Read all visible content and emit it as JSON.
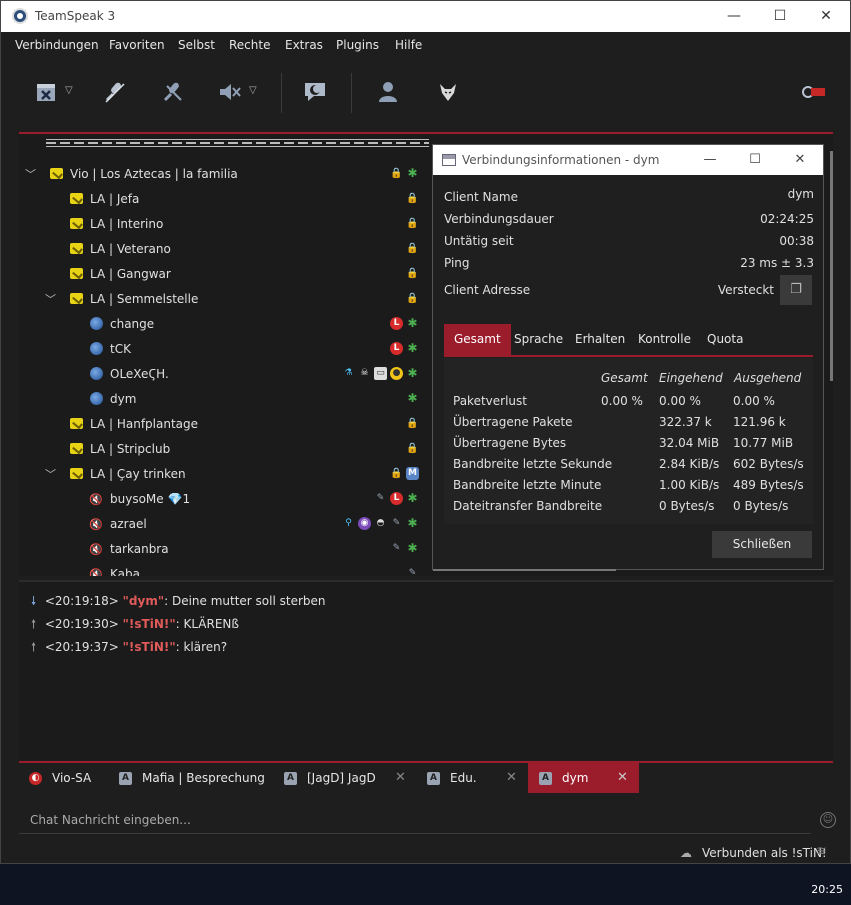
{
  "window": {
    "title": "TeamSpeak 3"
  },
  "menu": [
    "Verbindungen",
    "Favoriten",
    "Selbst",
    "Rechte",
    "Extras",
    "Plugins",
    "Hilfe"
  ],
  "tree": [
    {
      "label": "Vio | Los Aztecas | la familia",
      "kind": "server-channel",
      "level": 0,
      "expanded": true
    },
    {
      "label": "LA | Jefa",
      "kind": "channel",
      "level": 1
    },
    {
      "label": "LA | Interino",
      "kind": "channel",
      "level": 1
    },
    {
      "label": "LA | Veterano",
      "kind": "channel",
      "level": 1
    },
    {
      "label": "LA | Gangwar",
      "kind": "channel",
      "level": 1
    },
    {
      "label": "LA | Semmelstelle",
      "kind": "channel",
      "level": 1,
      "expanded": true
    },
    {
      "label": "change",
      "kind": "user",
      "level": 2
    },
    {
      "label": "tCK",
      "kind": "user",
      "level": 2
    },
    {
      "label": "OLeXeϚH.",
      "kind": "user",
      "level": 2
    },
    {
      "label": "dym",
      "kind": "user",
      "level": 2
    },
    {
      "label": "LA | Hanfplantage",
      "kind": "channel",
      "level": 1
    },
    {
      "label": "LA | Stripclub",
      "kind": "channel",
      "level": 1
    },
    {
      "label": "LA | Çay trinken",
      "kind": "channel",
      "level": 1,
      "expanded": true
    },
    {
      "label": "buysoMe",
      "suffix": "1",
      "kind": "muted-user",
      "level": 2
    },
    {
      "label": "azrael",
      "kind": "muted-user",
      "level": 2
    },
    {
      "label": "tarkanbra",
      "kind": "muted-user",
      "level": 2
    },
    {
      "label": "Kaba",
      "kind": "muted-user",
      "level": 2
    }
  ],
  "dialog": {
    "title": "Verbindungsinformationen - dym",
    "info": [
      {
        "label": "Client Name",
        "value": "dym"
      },
      {
        "label": "Verbindungsdauer",
        "value": "02:24:25"
      },
      {
        "label": "Untätig seit",
        "value": "00:38"
      },
      {
        "label": "Ping",
        "value": "23 ms ± 3.3"
      },
      {
        "label": "Client Adresse",
        "value": "Versteckt"
      }
    ],
    "tabs": [
      "Gesamt",
      "Sprache",
      "Erhalten",
      "Kontrolle",
      "Quota"
    ],
    "active_tab": "Gesamt",
    "stats_headers": [
      "Gesamt",
      "Eingehend",
      "Ausgehend"
    ],
    "stats": [
      {
        "label": "Paketverlust",
        "gesamt": "0.00 %",
        "ein": "0.00 %",
        "aus": "0.00 %"
      },
      {
        "label": "Übertragene Pakete",
        "gesamt": "",
        "ein": "322.37 k",
        "aus": "121.96 k"
      },
      {
        "label": "Übertragene Bytes",
        "gesamt": "",
        "ein": "32.04 MiB",
        "aus": "10.77 MiB"
      },
      {
        "label": "Bandbreite letzte Sekunde",
        "gesamt": "",
        "ein": "2.84 KiB/s",
        "aus": "602 Bytes/s"
      },
      {
        "label": "Bandbreite letzte Minute",
        "gesamt": "",
        "ein": "1.00 KiB/s",
        "aus": "489 Bytes/s"
      },
      {
        "label": "Dateitransfer Bandbreite",
        "gesamt": "",
        "ein": "0 Bytes/s",
        "aus": "0 Bytes/s"
      }
    ],
    "close_label": "Schließen"
  },
  "chat": [
    {
      "dir": "in",
      "time": "<20:19:18>",
      "nick": "\"dym\"",
      "msg": ": Deine mutter soll sterben"
    },
    {
      "dir": "out",
      "time": "<20:19:30>",
      "nick": "\"!sTiN!\"",
      "msg": ": KLÄRENß"
    },
    {
      "dir": "out",
      "time": "<20:19:37>",
      "nick": "\"!sTiN!\"",
      "msg": ": klären?"
    }
  ],
  "chat_tabs": [
    {
      "label": "Vio-SA",
      "icon": "server-icon",
      "closable": false,
      "active": false
    },
    {
      "label": "Mafia | Besprechung",
      "icon": "channel-a-icon",
      "closable": false,
      "active": false
    },
    {
      "label": "[JagD] JagD",
      "icon": "channel-a-icon",
      "closable": true,
      "active": false
    },
    {
      "label": "Edu.",
      "icon": "channel-a-icon",
      "closable": true,
      "active": false
    },
    {
      "label": "dym",
      "icon": "channel-a-icon",
      "closable": true,
      "active": true
    }
  ],
  "chat_input": {
    "placeholder": "Chat Nachricht eingeben..."
  },
  "status": {
    "text": "Verbunden als !sTiN!"
  },
  "taskbar": {
    "clock": "20:25"
  },
  "colors": {
    "accent": "#9b1d2c",
    "bg": "#1e1e1e",
    "nick": "#e05a5a"
  }
}
